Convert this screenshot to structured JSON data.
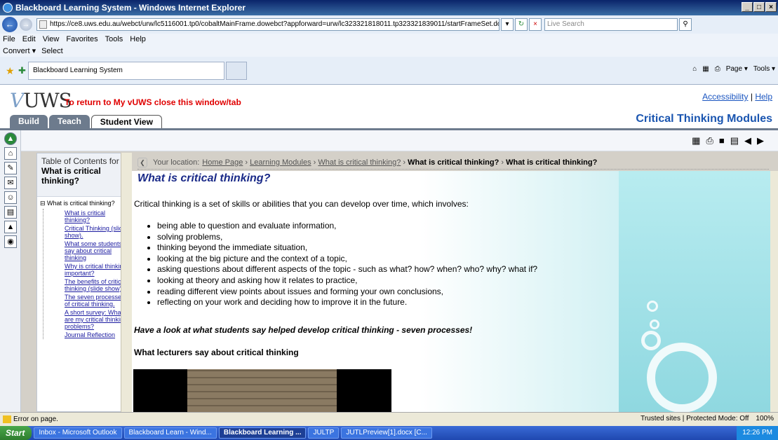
{
  "window": {
    "title": "Blackboard Learning System - Windows Internet Explorer",
    "controls": [
      "_",
      "□",
      "×"
    ]
  },
  "address": {
    "url": "https://ce8.uws.edu.au/webct/urw/lc5116001.tp0/cobaltMainFrame.dowebct?appforward=urw/lc323321818011.tp323321839011/startFrameSet.dowebct%3Fforward=organizer",
    "search_placeholder": "Live Search"
  },
  "menu": [
    "File",
    "Edit",
    "View",
    "Favorites",
    "Tools",
    "Help"
  ],
  "commands": {
    "convert": "Convert ▾",
    "select": "Select"
  },
  "browser_tab": {
    "label": "Blackboard Learning System"
  },
  "ie_toolbar": {
    "page": "Page ▾",
    "tools": "Tools ▾"
  },
  "header": {
    "logo": "UWS",
    "return_message": "To return to My vUWS close this window/tab",
    "accessibility": "Accessibility",
    "separator": "|",
    "help": "Help",
    "module_title": "Critical Thinking Modules",
    "tabs": [
      "Build",
      "Teach",
      "Student View"
    ]
  },
  "toc": {
    "heading": "Table of Contents for",
    "subject": "What is critical thinking?",
    "root": "What is critical thinking?",
    "items": [
      "What is critical thinking?",
      "Critical Thinking (slide show).",
      "What some students say about critical thinking",
      "Why is critical thinking important?",
      "The benefits of critical thinking (slide show).",
      "The seven processes of critical thinking.",
      "A short survey: What are my critical thinking problems?",
      "Journal Reflection"
    ]
  },
  "breadcrumb": {
    "prefix": "Your location:",
    "links": [
      "Home Page",
      "Learning Modules",
      "What is critical thinking?"
    ],
    "current": [
      "What is critical thinking?",
      "What is critical thinking?"
    ]
  },
  "content": {
    "title": "What is critical thinking?",
    "intro": "Critical thinking is a set of skills or abilities that you can develop over time, which involves:",
    "bullets": [
      "being able to question and evaluate information,",
      "solving problems,",
      "thinking beyond the immediate situation,",
      "looking at the big picture and the context of a topic,",
      "asking questions about different aspects of the topic - such as what? how? when? who? why? what if?",
      "looking at theory and asking how it relates to practice,",
      "reading different view points about issues and forming your own conclusions,",
      "reflecting on your work and deciding how to improve it in the future."
    ],
    "seven_processes": "Have a look at what students say helped develop critical thinking - seven processes!",
    "lecturers_heading": "What lecturers say about critical thinking"
  },
  "status": {
    "message": "Error on page.",
    "zone": "Trusted sites | Protected Mode: Off",
    "zoom": "100%"
  },
  "taskbar": {
    "start": "Start",
    "tasks": [
      "Inbox - Microsoft Outlook",
      "Blackboard Learn - Wind...",
      "Blackboard Learning ...",
      "JULTP",
      "JUTLPreview[1].docx [C..."
    ],
    "clock": "12:26 PM"
  }
}
